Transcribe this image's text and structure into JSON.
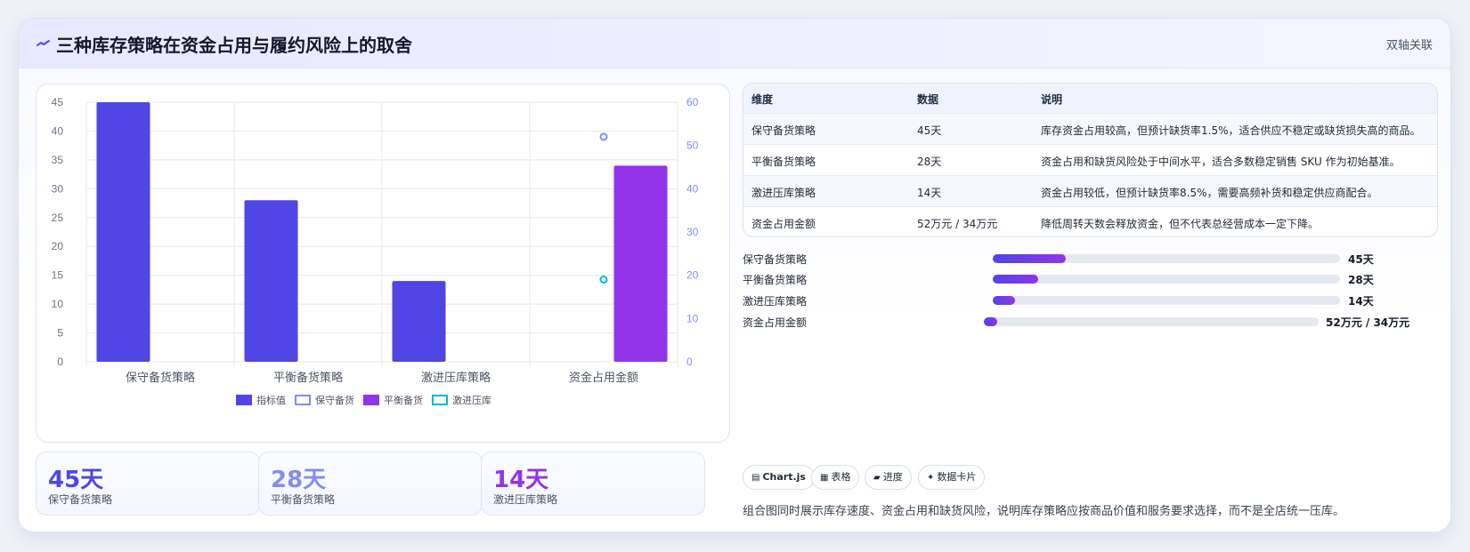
{
  "header": {
    "title": "三种库存策略在资金占用与履约风险上的取舍",
    "badge": "双轴关联"
  },
  "colors": {
    "indigo": "#4f46e5",
    "purple": "#9333ea",
    "lavender": "#818cf8",
    "teal": "#06b6d4"
  },
  "chart_data": {
    "type": "bar",
    "categories": [
      "保守备货策略",
      "平衡备货策略",
      "激进压库策略",
      "资金占用金额"
    ],
    "series": [
      {
        "name": "指标值",
        "type": "bar",
        "axis": "left",
        "color": "#4f46e5",
        "values": [
          45,
          28,
          14,
          null
        ]
      },
      {
        "name": "保守备货",
        "type": "scatter",
        "axis": "right",
        "color": "#818cf8",
        "values": [
          null,
          null,
          null,
          52
        ]
      },
      {
        "name": "平衡备货",
        "type": "bar",
        "axis": "left",
        "color": "#9333ea",
        "values": [
          null,
          null,
          null,
          34
        ]
      },
      {
        "name": "激进压库",
        "type": "scatter",
        "axis": "right",
        "color": "#06b6d4",
        "values": [
          null,
          null,
          null,
          19
        ]
      }
    ],
    "y_left": {
      "min": 0,
      "max": 45,
      "ticks": [
        0,
        5,
        10,
        15,
        20,
        25,
        30,
        35,
        40,
        45
      ]
    },
    "y_right": {
      "min": 0,
      "max": 60,
      "ticks": [
        0,
        10,
        20,
        30,
        40,
        50,
        60
      ]
    },
    "grid": true,
    "legend": "bottom"
  },
  "kpis": [
    {
      "value": "45天",
      "label": "保守备货策略",
      "color": "#4f46e5"
    },
    {
      "value": "28天",
      "label": "平衡备货策略",
      "color": "#818cf8"
    },
    {
      "value": "14天",
      "label": "激进压库策略",
      "color": "#9333ea"
    }
  ],
  "table": {
    "headers": [
      "维度",
      "数据",
      "说明"
    ],
    "rows": [
      [
        "保守备货策略",
        "45天",
        "库存资金占用较高，但预计缺货率1.5%，适合供应不稳定或缺货损失高的商品。"
      ],
      [
        "平衡备货策略",
        "28天",
        "资金占用和缺货风险处于中间水平，适合多数稳定销售 SKU 作为初始基准。"
      ],
      [
        "激进压库策略",
        "14天",
        "资金占用较低，但预计缺货率8.5%，需要高频补货和稳定供应商配合。"
      ],
      [
        "资金占用金额",
        "52万元 / 34万元",
        "降低周转天数会释放资金，但不代表总经营成本一定下降。"
      ]
    ]
  },
  "progress": [
    {
      "label": "保守备货策略",
      "value": "45天",
      "fraction": 0.21
    },
    {
      "label": "平衡备货策略",
      "value": "28天",
      "fraction": 0.13
    },
    {
      "label": "激进压库策略",
      "value": "14天",
      "fraction": 0.065
    },
    {
      "label": "资金占用金额",
      "value": "52万元 / 34万元",
      "fraction": 0.04
    }
  ],
  "tags": [
    {
      "icon": "▤",
      "label": "Chart.js"
    },
    {
      "icon": "▦",
      "label": "表格"
    },
    {
      "icon": "▰",
      "label": "进度"
    },
    {
      "icon": "✦",
      "label": "数据卡片"
    }
  ],
  "note": "组合图同时展示库存速度、资金占用和缺货风险，说明库存策略应按商品价值和服务要求选择，而不是全店统一压库。"
}
